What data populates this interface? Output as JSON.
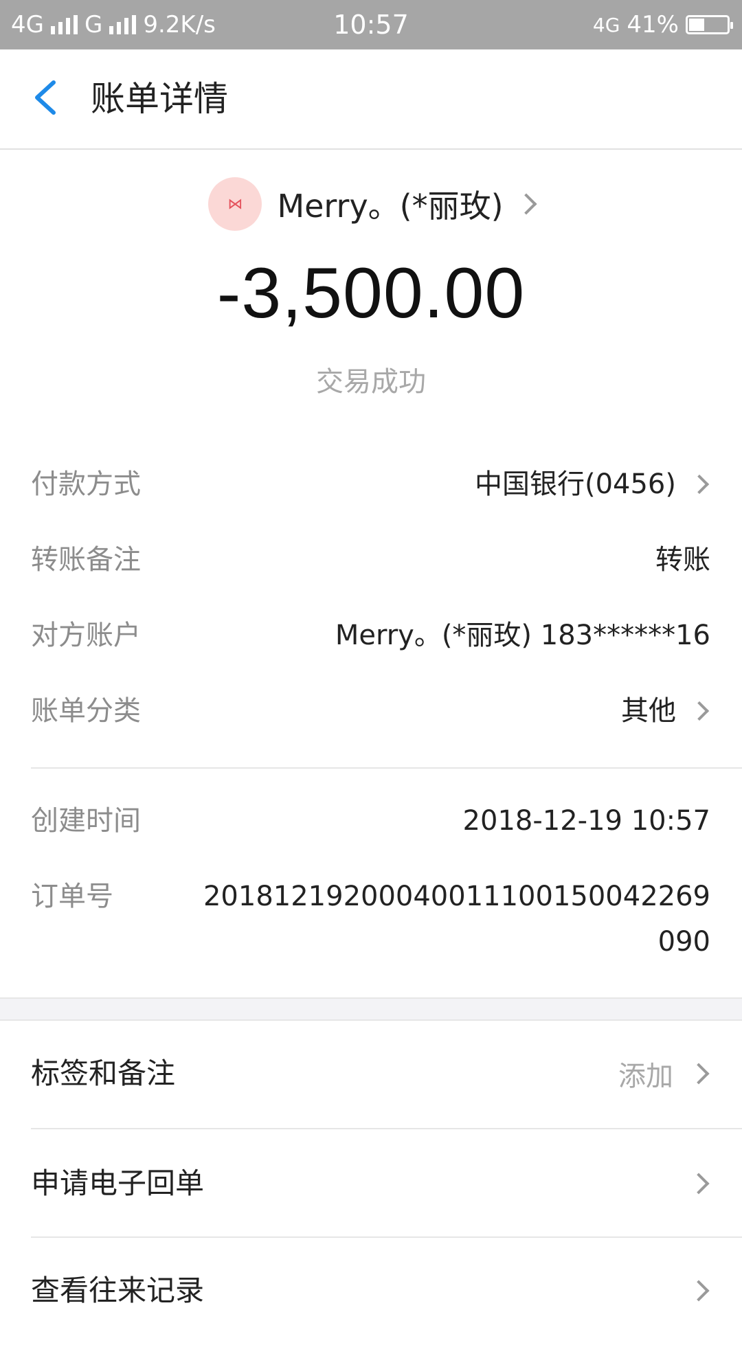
{
  "status_bar": {
    "network1": "4G",
    "network2": "G",
    "speed": "9.2K/s",
    "time": "10:57",
    "lte": "4G",
    "battery": "41%",
    "battery_level": 0.41
  },
  "nav": {
    "title": "账单详情"
  },
  "header": {
    "payee": "Merry。(*丽玫)",
    "amount": "-3,500.00",
    "status": "交易成功"
  },
  "details": [
    {
      "label": "付款方式",
      "value": "中国银行(0456)"
    },
    {
      "label": "转账备注",
      "value": "转账"
    },
    {
      "label": "对方账户",
      "value": "Merry。(*丽玫) 183******16"
    },
    {
      "label": "账单分类",
      "value": "其他"
    },
    {
      "label": "创建时间",
      "value": "2018-12-19 10:57"
    },
    {
      "label": "订单号",
      "value": "20181219200040011100150042269090"
    }
  ],
  "actions": [
    {
      "label": "标签和备注",
      "hint": "添加"
    },
    {
      "label": "申请电子回单",
      "hint": ""
    },
    {
      "label": "查看往来记录",
      "hint": ""
    }
  ]
}
